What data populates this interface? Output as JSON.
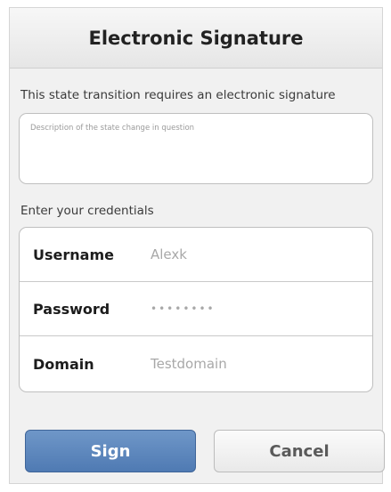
{
  "dialog": {
    "title": "Electronic Signature",
    "instruction": "This state transition requires an electronic signature",
    "description_placeholder": "Description of the state change in question",
    "credentials_label": "Enter your credentials"
  },
  "credentials": {
    "username": {
      "label": "Username",
      "value": "Alexk"
    },
    "password": {
      "label": "Password",
      "value": "••••••••"
    },
    "domain": {
      "label": "Domain",
      "value": "Testdomain"
    }
  },
  "buttons": {
    "sign_label": "Sign",
    "cancel_label": "Cancel"
  },
  "colors": {
    "primary": "#5a84bd",
    "secondary": "#f2f2f2"
  }
}
